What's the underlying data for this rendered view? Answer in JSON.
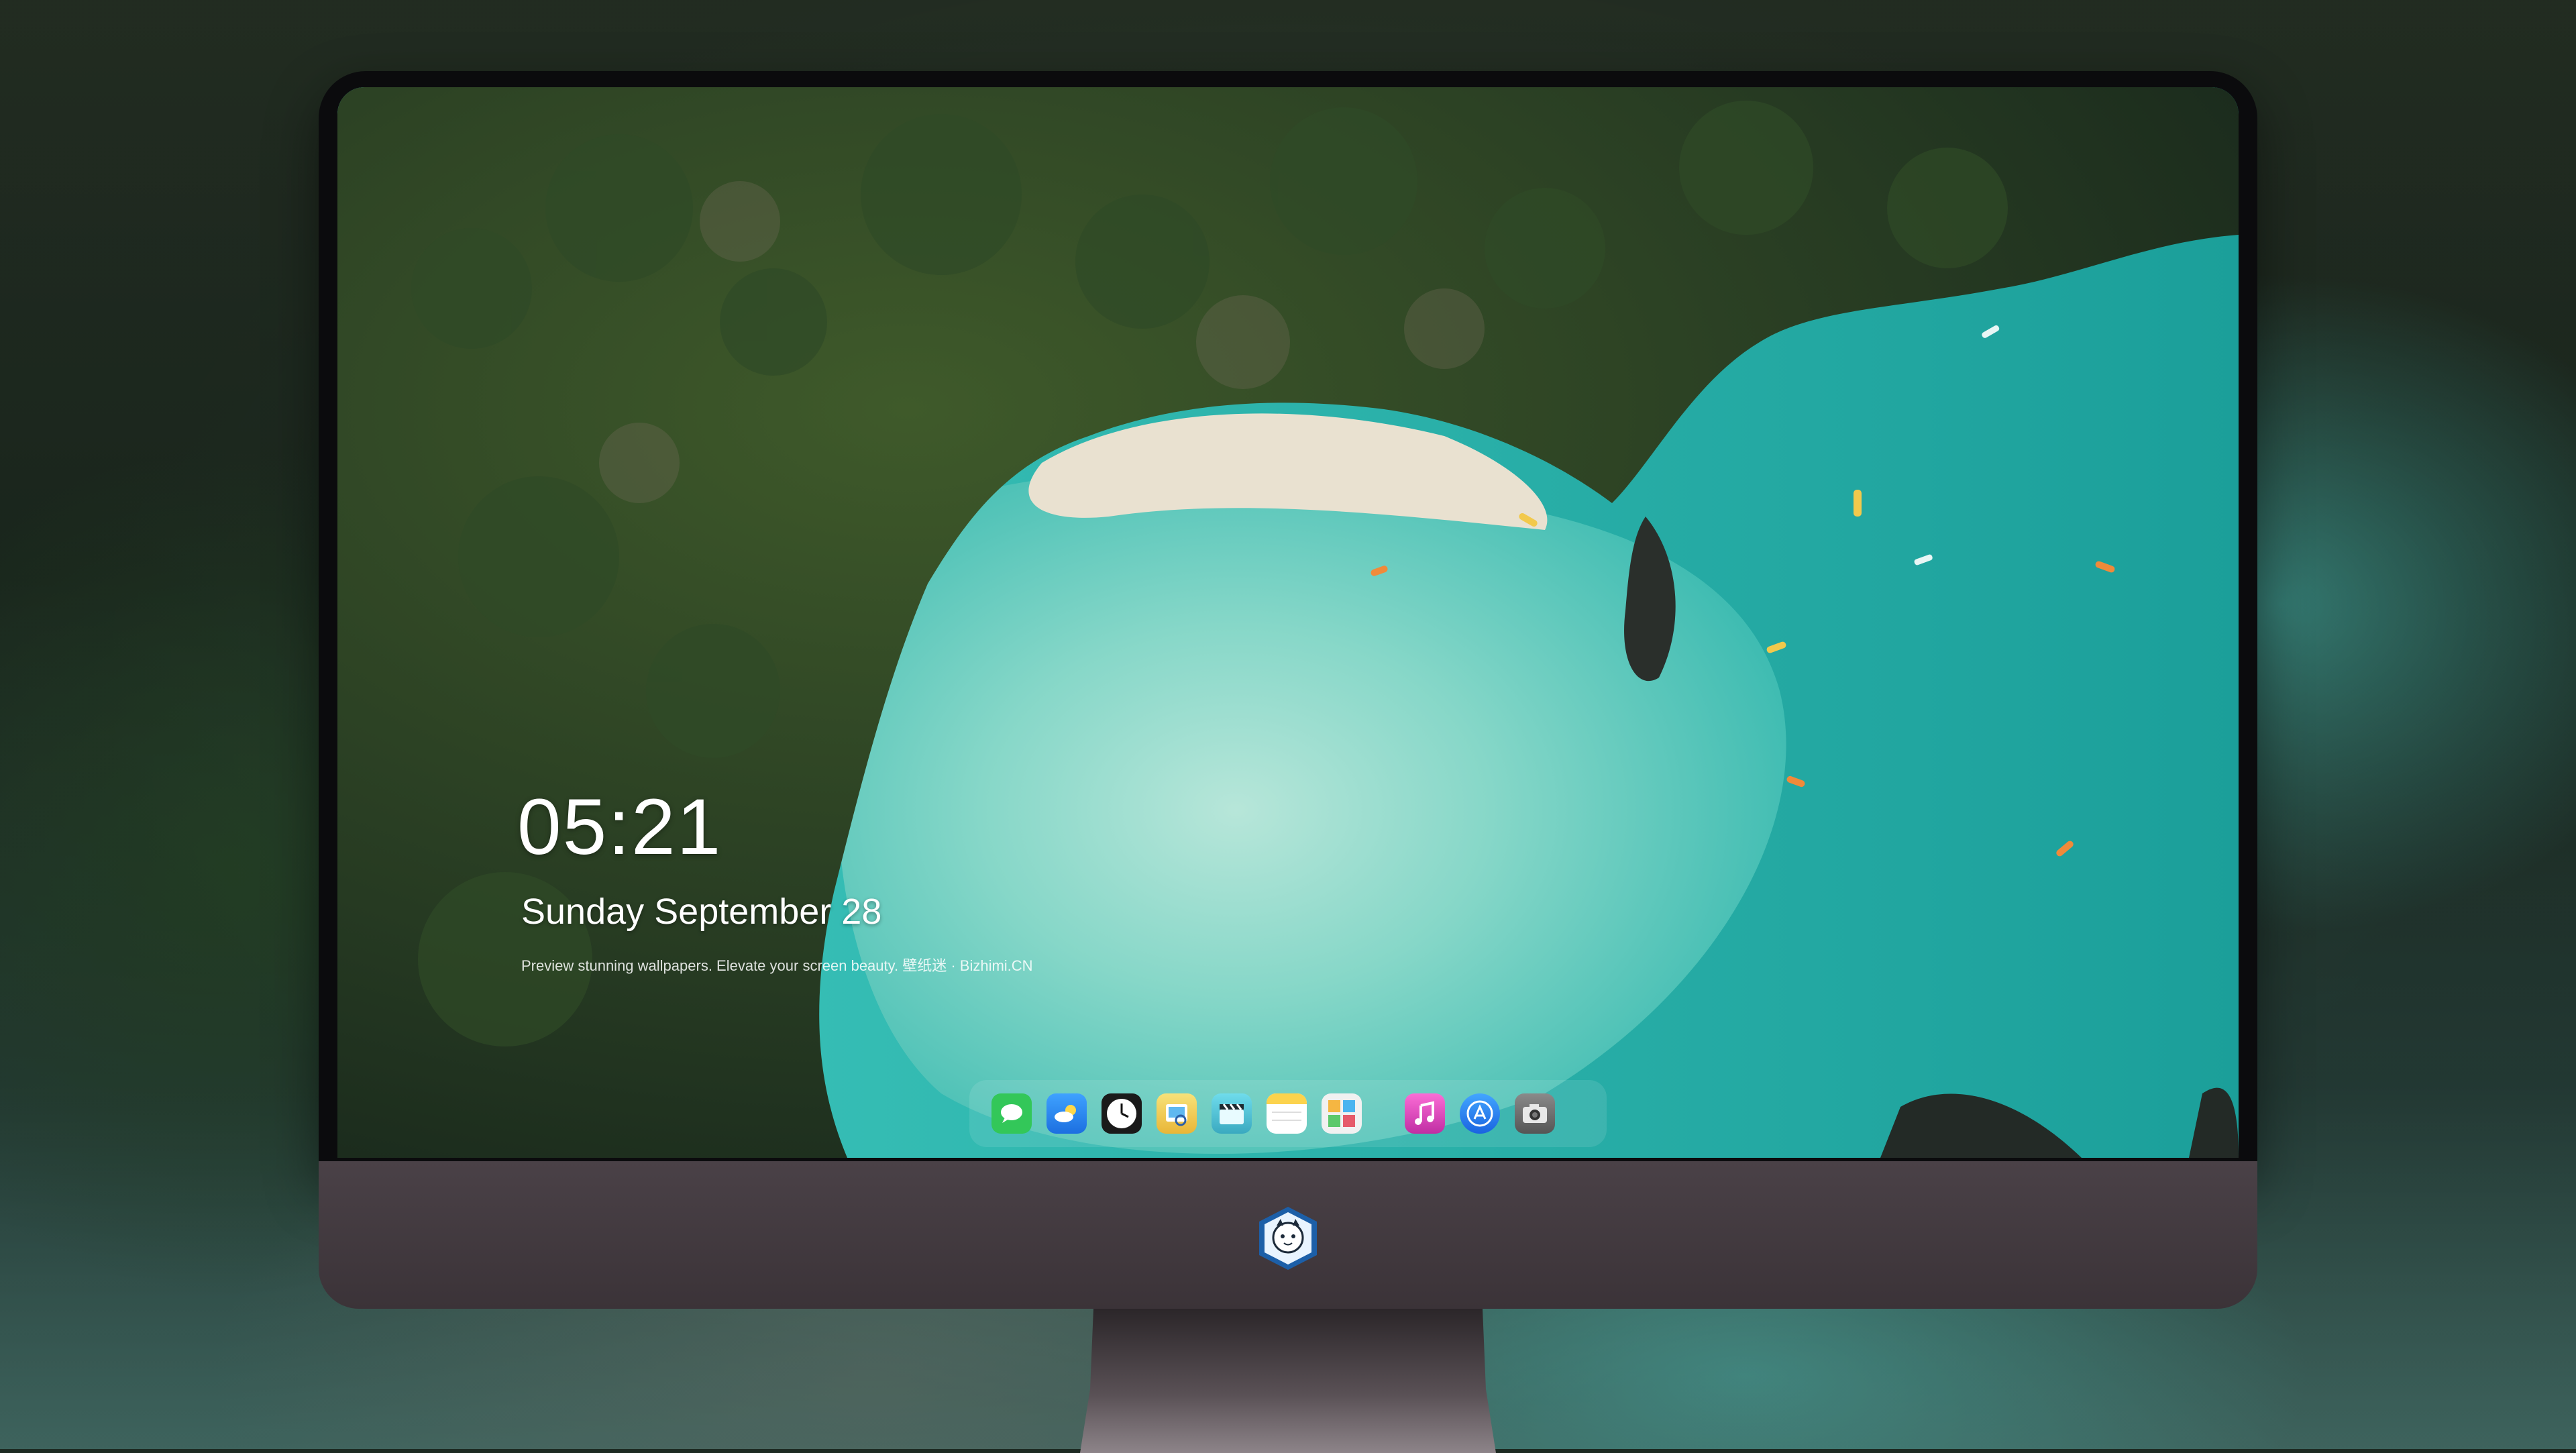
{
  "lockscreen": {
    "time": "05:21",
    "date": "Sunday September  28",
    "caption": "Preview stunning wallpapers. Elevate your screen beauty. 壁纸迷 · Bizhimi.CN"
  },
  "dock": {
    "items": [
      {
        "name": "messages-icon",
        "color": "#33c759"
      },
      {
        "name": "weather-icon",
        "color": "#2f8ff5"
      },
      {
        "name": "clock-icon",
        "color": "#1a1a1a"
      },
      {
        "name": "preview-icon",
        "color": "#f2d34a"
      },
      {
        "name": "claquette-icon",
        "color": "#52c7d8"
      },
      {
        "name": "notes-icon",
        "color": "#fcd34d"
      },
      {
        "name": "photo-browser-icon",
        "color": "#e8e8e8"
      },
      {
        "name": "music-icon",
        "color": "#e944b9"
      },
      {
        "name": "app-store-icon",
        "color": "#2b7ff0"
      },
      {
        "name": "camera-icon",
        "color": "#6b6b6b"
      }
    ]
  },
  "colors": {
    "monitor_chin": "#3f373c",
    "bezel": "#0b0b0d",
    "water": "#3fc6bf",
    "forest": "#22321f"
  }
}
